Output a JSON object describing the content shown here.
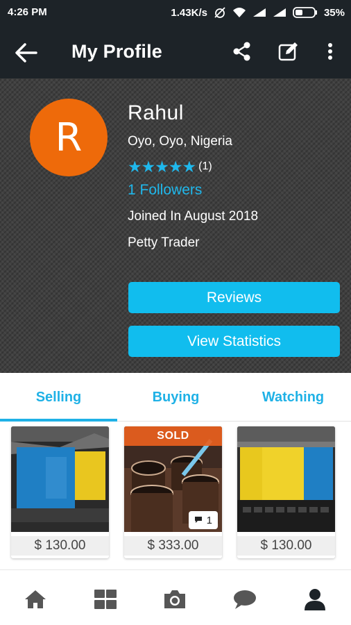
{
  "status_bar": {
    "time": "4:26 PM",
    "network_speed": "1.43K/s",
    "battery": "35%"
  },
  "app_bar": {
    "title": "My Profile"
  },
  "profile": {
    "avatar_letter": "R",
    "avatar_color": "#ee6a0a",
    "name": "Rahul",
    "location": "Oyo, Oyo, Nigeria",
    "stars": "★★★★★",
    "rating_count": "(1)",
    "followers": "1 Followers",
    "joined": "Joined In August 2018",
    "trader_type": "Petty Trader"
  },
  "buttons": {
    "reviews": "Reviews",
    "view_statistics": "View Statistics"
  },
  "tabs": [
    {
      "label": "Selling",
      "selected": true
    },
    {
      "label": "Buying",
      "selected": false
    },
    {
      "label": "Watching",
      "selected": false
    }
  ],
  "listings": [
    {
      "price": "$ 130.00"
    },
    {
      "price": "$ 333.00",
      "badge": "SOLD",
      "comments": "1"
    },
    {
      "price": "$ 130.00"
    }
  ],
  "bottom_nav": [
    "home-icon",
    "categories-icon",
    "camera-icon",
    "messages-icon",
    "profile-icon"
  ],
  "colors": {
    "accent": "#1fb1e6",
    "app_bar": "#1d2328",
    "sold": "#e8601e"
  }
}
